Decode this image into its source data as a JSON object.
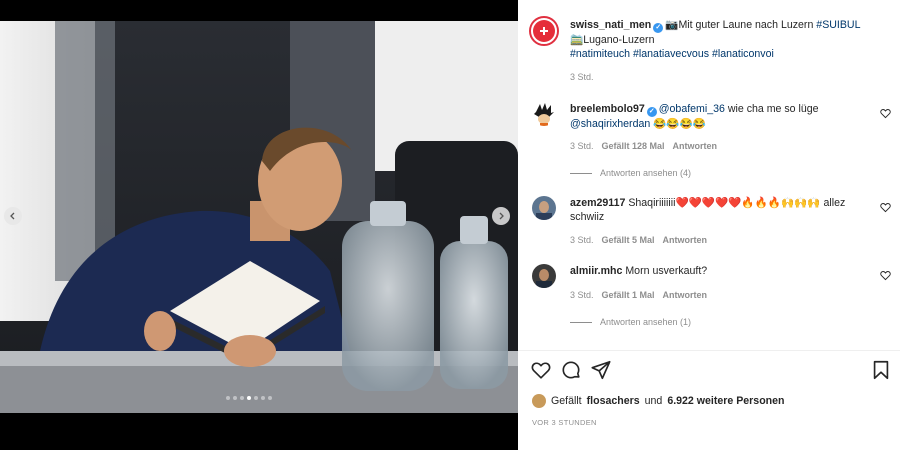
{
  "post": {
    "username": "swiss_nati_men",
    "caption_emoji_camera": "📷",
    "caption_text": "Mit guter Laune nach Luzern",
    "caption_tag1": "#SUIBUL",
    "caption_emoji_train": "🚞",
    "caption_line2": "Lugano-Luzern",
    "hashtags": [
      "#natimiteuch",
      "#lanatiavecvous",
      "#lanaticonvoi"
    ],
    "time": "3 Std."
  },
  "comments": [
    {
      "username": "breelembolo97",
      "verified": true,
      "mention": "@obafemi_36",
      "text": "wie cha me so lüge",
      "mention2": "@shaqirixherdan",
      "emojis": "😂😂😂😂",
      "time": "3 Std.",
      "likes": "Gefällt 128 Mal",
      "reply": "Antworten",
      "view_replies": "Antworten ansehen (4)"
    },
    {
      "username": "azem29117",
      "text": "Shaqiriiiiiii",
      "emojis": "❤️❤️❤️❤️❤️🔥🔥🔥🙌🙌🙌",
      "text2": "allez schwiiz",
      "time": "3 Std.",
      "likes": "Gefällt 5 Mal",
      "reply": "Antworten"
    },
    {
      "username": "almiir.mhc",
      "text": "Morn usverkauft?",
      "time": "3 Std.",
      "likes": "Gefällt 1 Mal",
      "reply": "Antworten",
      "view_replies": "Antworten ansehen (1)"
    }
  ],
  "likes_summary": {
    "prefix": "Gefällt",
    "user": "flosachers",
    "connector": "und",
    "others": "6.922 weitere Personen"
  },
  "post_age": "VOR 3 STUNDEN",
  "carousel": {
    "count": 7,
    "active_index": 3
  },
  "icons": [
    "chevron-left-icon",
    "chevron-right-icon",
    "heart-icon",
    "comment-icon",
    "share-icon",
    "bookmark-icon"
  ],
  "colors": {
    "link": "#00376b",
    "verified": "#3897f0",
    "brand_red": "#e52e3a",
    "meta_gray": "#8e8e8e"
  }
}
